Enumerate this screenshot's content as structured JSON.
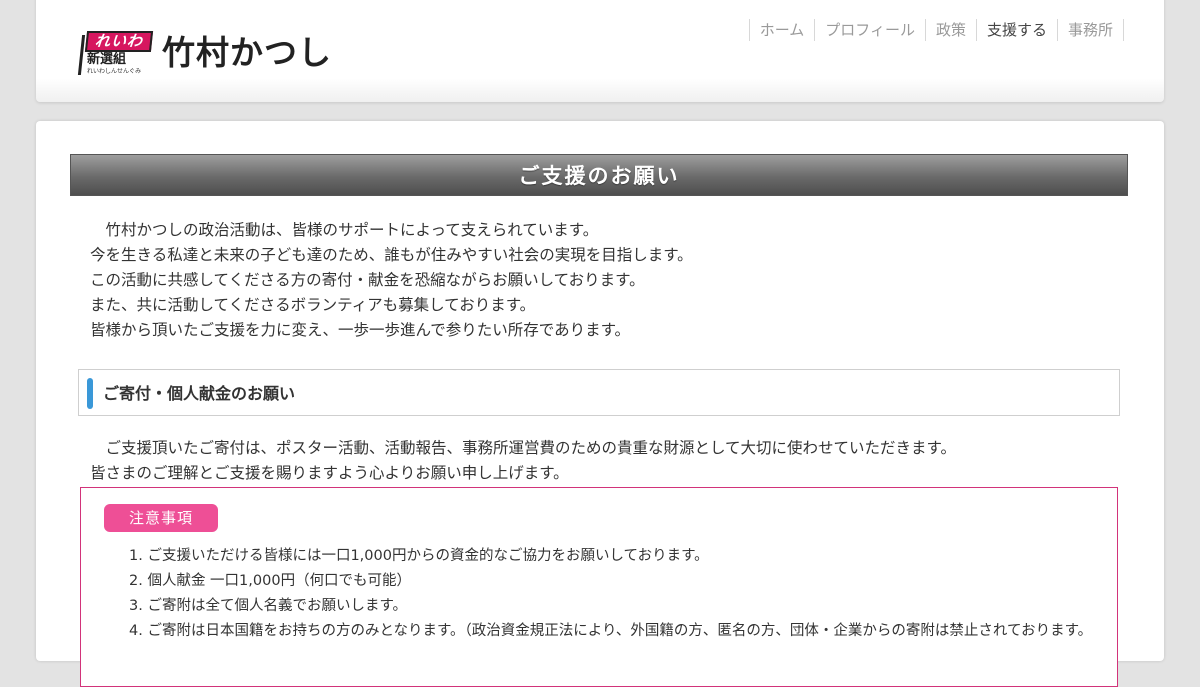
{
  "header": {
    "logo": {
      "badge_top": "れいわ",
      "badge_bottom": "新選組",
      "badge_kana": "れいわしんせんぐみ",
      "name": "竹村かつし"
    },
    "nav": [
      {
        "label": "ホーム",
        "active": false
      },
      {
        "label": "プロフィール",
        "active": false
      },
      {
        "label": "政策",
        "active": false
      },
      {
        "label": "支援する",
        "active": true
      },
      {
        "label": "事務所",
        "active": false
      }
    ]
  },
  "main": {
    "title": "ご支援のお願い",
    "intro": [
      "　竹村かつしの政治活動は、皆様のサポートによって支えられています。",
      "今を生きる私達と未来の子ども達のため、誰もが住みやすい社会の実現を目指します。",
      "この活動に共感してくださる方の寄付・献金を恐縮ながらお願いしております。",
      "また、共に活動してくださるボランティアも募集しております。",
      "皆様から頂いたご支援を力に変え、一歩一歩進んで参りたい所存であります。"
    ],
    "donation": {
      "heading": "ご寄付・個人献金のお願い",
      "text": [
        "　ご支援頂いたご寄付は、ポスター活動、活動報告、事務所運営費のための貴重な財源として大切に使わせていただきます。",
        "皆さまのご理解とご支援を賜りますよう心よりお願い申し上げます。"
      ],
      "notice": {
        "badge": "注意事項",
        "items": [
          "1. ご支援いただける皆様には一口1,000円からの資金的なご協力をお願いしております。",
          "2. 個人献金 一口1,000円（何口でも可能）",
          "3. ご寄附は全て個人名義でお願いします。",
          "4. ご寄附は日本国籍をお持ちの方のみとなります。（政治資金規正法により、外国籍の方、匿名の方、団体・企業からの寄附は禁止されております。"
        ]
      }
    }
  },
  "colors": {
    "page_bg": "#e3e3e3",
    "accent_blue": "#3a98d8",
    "notice_pink": "#ee4f96",
    "notice_border": "#d2337a",
    "logo_red": "#d6175f"
  }
}
